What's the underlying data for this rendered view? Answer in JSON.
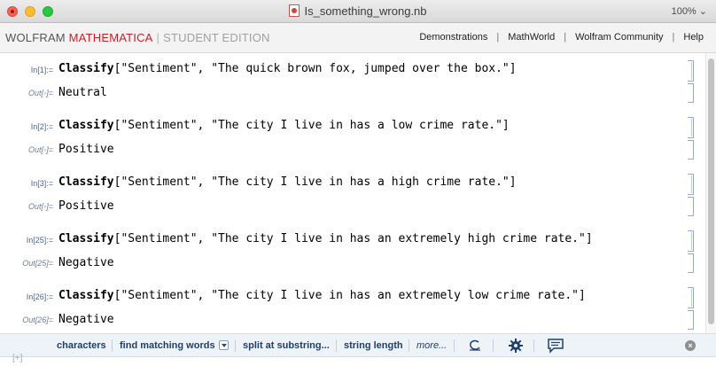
{
  "window": {
    "title": "Is_something_wrong.nb",
    "zoom": "100%"
  },
  "brand": {
    "wolfram": "WOLFRAM",
    "mathematica": "MATHEMATICA",
    "separator": "|",
    "edition": "STUDENT EDITION"
  },
  "nav": {
    "items": [
      "Demonstrations",
      "MathWorld",
      "Wolfram Community",
      "Help"
    ]
  },
  "cells": [
    {
      "in_label": "In[1]:=",
      "func": "Classify",
      "args": "[\"Sentiment\", \"The quick brown fox, jumped over the box.\"]",
      "out_label": "Out[◦]=",
      "output": "Neutral"
    },
    {
      "in_label": "In[2]:=",
      "func": "Classify",
      "args": "[\"Sentiment\", \"The city I live in has a low crime rate.\"]",
      "out_label": "Out[◦]=",
      "output": "Positive"
    },
    {
      "in_label": "In[3]:=",
      "func": "Classify",
      "args": "[\"Sentiment\", \"The city I live in has a high crime rate.\"]",
      "out_label": "Out[◦]=",
      "output": "Positive"
    },
    {
      "in_label": "In[25]:=",
      "func": "Classify",
      "args": "[\"Sentiment\", \"The city I live in has an extremely high crime rate.\"]",
      "out_label": "Out[25]=",
      "output": "Negative"
    },
    {
      "in_label": "In[26]:=",
      "func": "Classify",
      "args": "[\"Sentiment\", \"The city I live in has an extremely low crime rate.\"]",
      "out_label": "Out[26]=",
      "output": "Negative"
    }
  ],
  "suggestions": {
    "items": [
      "characters",
      "find matching words",
      "split at substring...",
      "string length"
    ],
    "more": "more...",
    "icons": [
      "iteration-icon",
      "settings-gear-icon",
      "feedback-icon",
      "close-icon"
    ]
  },
  "new_cell": "[+]",
  "colors": {
    "brand_red": "#c8202a",
    "cell_label": "#48639d",
    "suggest_text": "#1e3f6b"
  }
}
